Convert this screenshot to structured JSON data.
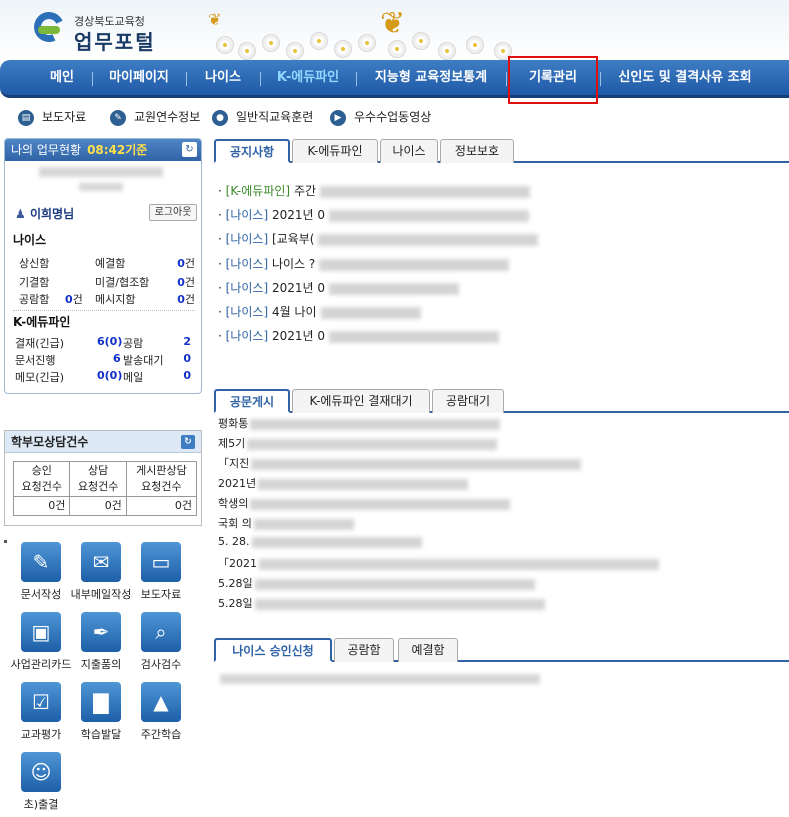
{
  "header": {
    "org": "경상북도교육청",
    "title": "업무포털"
  },
  "nav": {
    "items": [
      {
        "label": "메인"
      },
      {
        "label": "마이페이지"
      },
      {
        "label": "나이스"
      },
      {
        "label": "K-에듀파인"
      },
      {
        "label": "지능형 교육정보통계"
      },
      {
        "label": "기록관리"
      },
      {
        "label": "신인도 및 결격사유 조회"
      }
    ],
    "active": "K-에듀파인"
  },
  "sublinks": [
    {
      "label": "보도자료",
      "icon": "newspaper-icon",
      "glyph": "▤"
    },
    {
      "label": "교원연수정보",
      "icon": "graduation-icon",
      "glyph": "✎"
    },
    {
      "label": "일반직교육훈련",
      "icon": "person-icon",
      "glyph": "●"
    },
    {
      "label": "우수수업동영상",
      "icon": "video-icon",
      "glyph": "▶"
    }
  ],
  "status_panel": {
    "title": "나의 업무현황",
    "time": "08:42기준",
    "user_name": "이희명님",
    "logout_label": "로그아웃",
    "neis": {
      "title": "나이스",
      "rows": [
        [
          {
            "label": "상신함",
            "value": ""
          },
          {
            "label": "예결함",
            "value": "0",
            "unit": "건"
          }
        ],
        [
          {
            "label": "기결함",
            "value": ""
          },
          {
            "label": "미결/협조함",
            "value": "0",
            "unit": "건"
          }
        ],
        [
          {
            "label": "공람함",
            "value": "0",
            "unit": "건"
          },
          {
            "label": "메시지함",
            "value": "0",
            "unit": "건"
          }
        ]
      ]
    },
    "edufine": {
      "title": "K-에듀파인",
      "rows": [
        [
          {
            "label": "결재(긴급)",
            "value": "6(0)"
          },
          {
            "label": "공람",
            "value": "2"
          }
        ],
        [
          {
            "label": "문서진행",
            "value": "6"
          },
          {
            "label": "발송대기",
            "value": "0"
          }
        ],
        [
          {
            "label": "메모(긴급)",
            "value": "0(0)"
          },
          {
            "label": "메일",
            "value": "0"
          }
        ]
      ]
    }
  },
  "parent_counsel": {
    "title": "학부모상담건수",
    "headers": [
      [
        "승인",
        "요청건수"
      ],
      [
        "상담",
        "요청건수"
      ],
      [
        "게시판상담",
        "요청건수"
      ]
    ],
    "values": [
      "0건",
      "0건",
      "0건"
    ]
  },
  "quick_icons": [
    {
      "label": "문서작성",
      "icon": "document-edit-icon",
      "glyph": "✎"
    },
    {
      "label": "내부메일작성",
      "icon": "mail-icon",
      "glyph": "✉"
    },
    {
      "label": "보도자료",
      "icon": "monitor-icon",
      "glyph": "▭"
    },
    {
      "label": "사업관리카드",
      "icon": "card-icon",
      "glyph": "▣"
    },
    {
      "label": "지출품의",
      "icon": "pen-icon",
      "glyph": "✒"
    },
    {
      "label": "검사검수",
      "icon": "magnifier-icon",
      "glyph": "⌕"
    },
    {
      "label": "교과평가",
      "icon": "checklist-icon",
      "glyph": "☑"
    },
    {
      "label": "학습발달",
      "icon": "chart-icon",
      "glyph": "▇"
    },
    {
      "label": "주간학습",
      "icon": "picture-icon",
      "glyph": "▲"
    },
    {
      "label": "초)출결",
      "icon": "people-icon",
      "glyph": "☺"
    }
  ],
  "notice_tabs": {
    "tabs": [
      "공지사항",
      "K-에듀파인",
      "나이스",
      "정보보호"
    ],
    "active": "공지사항",
    "items": [
      {
        "category": "[K-에듀파인]",
        "text": "주간"
      },
      {
        "category": "[나이스]",
        "text": "2021년 0"
      },
      {
        "category": "[나이스]",
        "text": "[교육부("
      },
      {
        "category": "[나이스]",
        "text": "나이스 ?"
      },
      {
        "category": "[나이스]",
        "text": "2021년 0"
      },
      {
        "category": "[나이스]",
        "text": "4월 나이"
      },
      {
        "category": "[나이스]",
        "text": "2021년 0"
      }
    ]
  },
  "doc_tabs": {
    "tabs": [
      "공문게시",
      "K-에듀파인 결재대기",
      "공람대기"
    ],
    "active": "공문게시",
    "items": [
      "평화통",
      "제5기",
      "「지진",
      "2021년",
      "학생의",
      "국회 의",
      "5. 28.",
      "「2021",
      "5.28일",
      "5.28일"
    ]
  },
  "neis_tabs": {
    "tabs": [
      "나이스 승인신청",
      "공람함",
      "예결함"
    ],
    "active": "나이스 승인신청"
  }
}
